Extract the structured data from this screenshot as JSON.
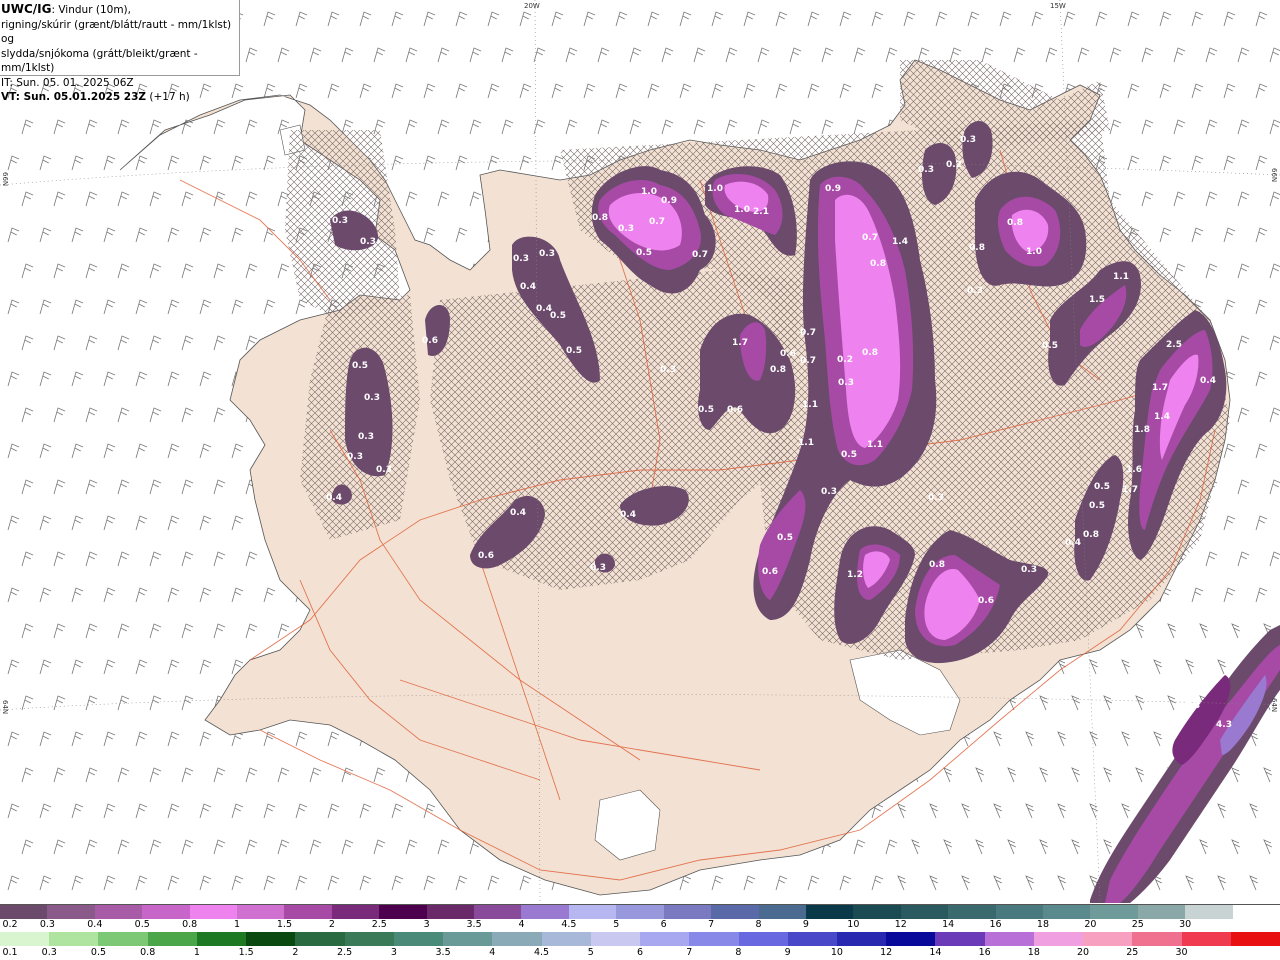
{
  "header": {
    "title_prefix": "UWC/IG",
    "title_rest": ": Vindur (10m),",
    "line2": "rigning/skúrir (grænt/blátt/rautt - mm/1klst) og",
    "line3": "slydda/snjókoma (grátt/bleikt/grænt - mm/1klst)",
    "line4": "IT: Sun. 05. 01. 2025 06Z",
    "line5_bold": "VT: Sun. 05.01.2025 23Z",
    "line5_rest": " (+17 h)"
  },
  "grid_labels": {
    "lon_20w": "20W",
    "lon_15w": "15W",
    "lat_66n_left": "66N",
    "lat_66n_right": "66N",
    "lat_64n_left": "64N",
    "lat_64n_right": "64N"
  },
  "precip_values": [
    {
      "v": "0.3"
    },
    {
      "v": "0.3"
    },
    {
      "v": "0.3"
    },
    {
      "v": "0.3"
    },
    {
      "v": "0.4"
    },
    {
      "v": "0.4"
    },
    {
      "v": "0.5"
    },
    {
      "v": "0.5"
    },
    {
      "v": "0.6"
    },
    {
      "v": "0.5"
    },
    {
      "v": "0.3"
    },
    {
      "v": "0.3"
    },
    {
      "v": "0.3"
    },
    {
      "v": "0.3"
    },
    {
      "v": "0.4"
    },
    {
      "v": "0.4"
    },
    {
      "v": "0.6"
    },
    {
      "v": "0.4"
    },
    {
      "v": "0.3"
    },
    {
      "v": "0.8"
    },
    {
      "v": "1.0"
    },
    {
      "v": "0.9"
    },
    {
      "v": "0.7"
    },
    {
      "v": "0.3"
    },
    {
      "v": "0.5"
    },
    {
      "v": "0.7"
    },
    {
      "v": "1.0"
    },
    {
      "v": "1.0"
    },
    {
      "v": "2.1"
    },
    {
      "v": "0.9"
    },
    {
      "v": "0.7"
    },
    {
      "v": "1.4"
    },
    {
      "v": "0.8"
    },
    {
      "v": "1.7"
    },
    {
      "v": "0.6"
    },
    {
      "v": "0.8"
    },
    {
      "v": "0.5"
    },
    {
      "v": "0.6"
    },
    {
      "v": "0.7"
    },
    {
      "v": "0.7"
    },
    {
      "v": "1.1"
    },
    {
      "v": "1.1"
    },
    {
      "v": "0.2"
    },
    {
      "v": "0.8"
    },
    {
      "v": "0.3"
    },
    {
      "v": "1.1"
    },
    {
      "v": "0.5"
    },
    {
      "v": "0.3"
    },
    {
      "v": "0.5"
    },
    {
      "v": "0.6"
    },
    {
      "v": "1.2"
    },
    {
      "v": "0.8"
    },
    {
      "v": "0.6"
    },
    {
      "v": "0.3"
    },
    {
      "v": "0.3"
    },
    {
      "v": "0.3"
    },
    {
      "v": "0.2"
    },
    {
      "v": "0.3"
    },
    {
      "v": "0.8"
    },
    {
      "v": "0.8"
    },
    {
      "v": "1.0"
    },
    {
      "v": "0.3"
    },
    {
      "v": "1.1"
    },
    {
      "v": "1.5"
    },
    {
      "v": "0.5"
    },
    {
      "v": "2.5"
    },
    {
      "v": "1.7"
    },
    {
      "v": "0.4"
    },
    {
      "v": "1.4"
    },
    {
      "v": "1.8"
    },
    {
      "v": "1.6"
    },
    {
      "v": "0.5"
    },
    {
      "v": "1.7"
    },
    {
      "v": "0.5"
    },
    {
      "v": "0.8"
    },
    {
      "v": "0.4"
    },
    {
      "v": "2.4"
    },
    {
      "v": "4.3"
    },
    {
      "v": "0.3"
    }
  ],
  "legend_snow": {
    "labels": [
      "0.2",
      "0.3",
      "0.4",
      "0.5",
      "0.8",
      "1",
      "1.5",
      "2",
      "2.5",
      "3",
      "3.5",
      "4",
      "4.5",
      "5",
      "6",
      "7",
      "8",
      "9",
      "10",
      "12",
      "14",
      "16",
      "18",
      "20",
      "25",
      "30"
    ],
    "colors": [
      "#6b4a6b",
      "#8a5a8a",
      "#a85ca8",
      "#c865c8",
      "#ee82ee",
      "#d070d0",
      "#a64aa6",
      "#7a2a7a",
      "#4d004d",
      "#6a2a6a",
      "#8a4a9a",
      "#9a7ad0",
      "#b6b6f0",
      "#9898dc",
      "#7a7ac0",
      "#5a6aa8",
      "#4a6a90",
      "#0a3a4a",
      "#1a4a52",
      "#2a5a60",
      "#3a6a6e",
      "#4a7a80",
      "#5a8a8e",
      "#6e9a9a",
      "#8aa8a8",
      "#c8d4d4",
      "#ffffff"
    ]
  },
  "legend_rain": {
    "labels": [
      "0.1",
      "0.3",
      "0.5",
      "0.8",
      "1",
      "1.5",
      "2",
      "2.5",
      "3",
      "3.5",
      "4",
      "4.5",
      "5",
      "6",
      "7",
      "8",
      "9",
      "10",
      "12",
      "14",
      "16",
      "18",
      "20",
      "25",
      "30"
    ],
    "colors": [
      "#d8f5d0",
      "#aee3a0",
      "#7cc874",
      "#4aa648",
      "#1e7a22",
      "#0a4a10",
      "#2a6a40",
      "#3a7a58",
      "#4a8a78",
      "#6a9a98",
      "#8aaab8",
      "#a8b8d8",
      "#c8c8f0",
      "#a8a8f0",
      "#8888e8",
      "#6868e0",
      "#4848c8",
      "#2828b0",
      "#0a0a9a",
      "#6a3ab8",
      "#b870d8",
      "#f0a0e0",
      "#f8a0c0",
      "#f07090",
      "#f03a50",
      "#e81010"
    ]
  }
}
